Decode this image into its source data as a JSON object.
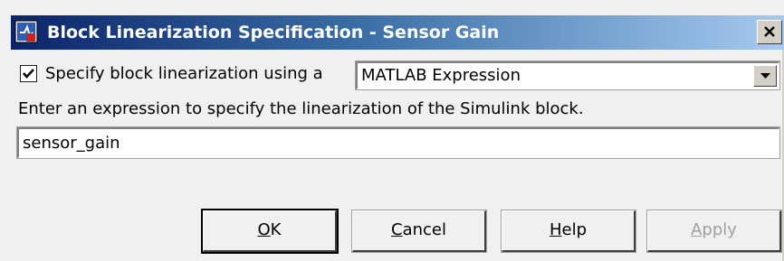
{
  "window": {
    "title": "Block Linearization Specification - Sensor Gain"
  },
  "icons": {
    "app": "simulink-block-icon",
    "close": "close-icon",
    "dropdown": "chevron-down-icon",
    "check": "checkmark-icon"
  },
  "spec": {
    "checkbox_label": "Specify block linearization using a",
    "checkbox_checked": true,
    "method_selected": "MATLAB Expression"
  },
  "expression": {
    "instruction": "Enter an expression to specify the linearization of the Simulink block.",
    "value": "sensor_gain"
  },
  "buttons": {
    "ok": {
      "mnemonic": "O",
      "rest": "K"
    },
    "cancel": {
      "mnemonic": "C",
      "rest": "ancel"
    },
    "help": {
      "mnemonic": "H",
      "rest": "elp"
    },
    "apply": {
      "mnemonic": "A",
      "rest": "pply",
      "disabled": true
    }
  },
  "colors": {
    "titlebar_start": "#0b246a",
    "titlebar_end": "#a6caf0",
    "dialog_bg": "#f0f0f0"
  }
}
